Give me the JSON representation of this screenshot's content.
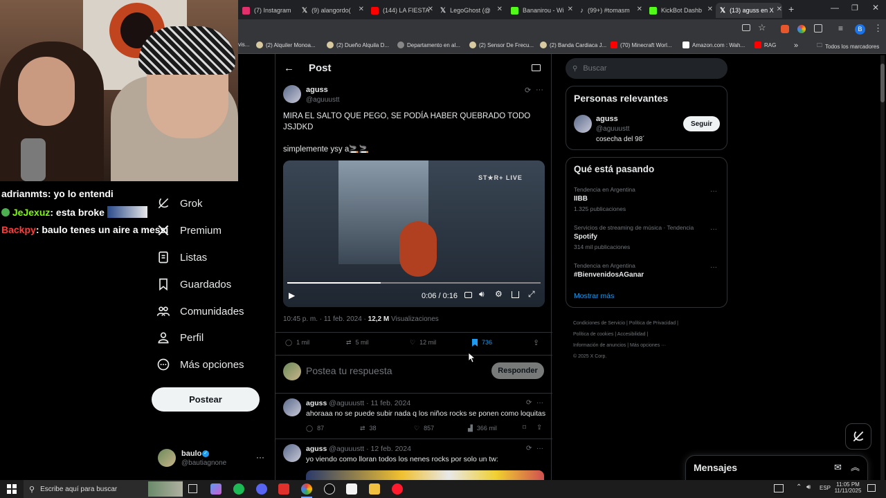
{
  "browser": {
    "tabs": [
      {
        "label": "(7) Instagram",
        "color": "#e1306c"
      },
      {
        "label": "(9) alangordo(",
        "color": "#ffffff"
      },
      {
        "label": "(144) LA FIESTA",
        "color": "#ff0000"
      },
      {
        "label": "LegoGhost (@",
        "color": "#ffffff"
      },
      {
        "label": "Bananirou - Wi",
        "color": "#53fc18"
      },
      {
        "label": "(99+) #tomasm",
        "color": "#ffffff"
      },
      {
        "label": "KickBot Dashb",
        "color": "#53fc18"
      },
      {
        "label": "(13) aguss en X",
        "color": "#ffffff"
      }
    ],
    "new_tab": "+",
    "bookmarks": [
      "vis...",
      "(2) Alquiler Monoa...",
      "(2) Dueño Alquila D...",
      "Departamento en al...",
      "(2) Sensor De Frecu...",
      "(2) Banda Cardiaca J...",
      "(70) Minecraft Worl...",
      "Amazon.com : Wah...",
      "RAG"
    ],
    "all_bookmarks": "Todos los marcadores",
    "profile_initial": "B"
  },
  "stream": {
    "chat": [
      {
        "user": "adrianmts",
        "user_color": "#ffffff",
        "message": ": yo lo entendi"
      },
      {
        "user": "JeJexuz",
        "user_color": "#7cfc00",
        "message": ": esta broke"
      },
      {
        "user": "Backpy",
        "user_color": "#ff3b3b",
        "message": ": baulo tenes un aire a messi"
      }
    ]
  },
  "left_nav": {
    "items": [
      {
        "label": "Grok",
        "icon": "grok-icon"
      },
      {
        "label": "Premium",
        "icon": "x-premium-icon"
      },
      {
        "label": "Listas",
        "icon": "list-icon"
      },
      {
        "label": "Guardados",
        "icon": "bookmark-icon"
      },
      {
        "label": "Comunidades",
        "icon": "communities-icon"
      },
      {
        "label": "Perfil",
        "icon": "profile-icon"
      },
      {
        "label": "Más opciones",
        "icon": "more-icon"
      }
    ],
    "post_button": "Postear",
    "account": {
      "name": "baulo",
      "handle": "@bautiagnone"
    }
  },
  "post": {
    "header_title": "Post",
    "author_name": "aguss",
    "author_handle": "@aguuustt",
    "text_line1": "MIRA EL SALTO QUE PEGO, SE PODÍA HABER QUEBRADO TODO JSJDKD",
    "text_line2": "simplemente ysy a🚬🚬",
    "video": {
      "watermark": "ST★R+ LIVE",
      "time": "0:06 / 0:16",
      "progress": 0.37
    },
    "timestamp": "10:45 p. m. · 11 feb. 2024 ·",
    "views_count": "12,2 M",
    "views_label": "Visualizaciones",
    "stats": {
      "replies": "1 mil",
      "reposts": "5 mil",
      "likes": "12 mil",
      "bookmarks": "736"
    },
    "reply_placeholder": "Postea tu respuesta",
    "reply_button": "Responder"
  },
  "replies": [
    {
      "name": "aguss",
      "handle": "@aguuustt · 11 feb. 2024",
      "text": "ahoraaa no se puede subir nada q los niños rocks se ponen como loquitas",
      "replies": "87",
      "reposts": "38",
      "likes": "857",
      "views": "366 mil"
    },
    {
      "name": "aguss",
      "handle": "@aguuustt · 12 feb. 2024",
      "text": "yo viendo como lloran todos los nenes rocks por solo un tw:"
    }
  ],
  "sidebar": {
    "search_placeholder": "Buscar",
    "relevant": {
      "title": "Personas relevantes",
      "name": "aguss",
      "handle": "@aguuustt",
      "bio": "cosecha del 98´",
      "follow": "Seguir"
    },
    "trending": {
      "title": "Qué está pasando",
      "items": [
        {
          "context": "Tendencia en Argentina",
          "topic": "IIBB",
          "count": "1.325 publicaciones"
        },
        {
          "context": "Servicios de streaming de música · Tendencia",
          "topic": "Spotify",
          "count": "314 mil publicaciones"
        },
        {
          "context": "Tendencia en Argentina",
          "topic": "#BienvenidosAGanar",
          "count": ""
        }
      ],
      "show_more": "Mostrar más"
    },
    "footer": {
      "row1": [
        "Condiciones de Servicio",
        "Política de Privacidad"
      ],
      "row2": [
        "Política de cookies",
        "Accesibilidad"
      ],
      "row3": [
        "Información de anuncios",
        "Más opciones ···"
      ],
      "copyright": "© 2025 X Corp."
    },
    "messages": "Mensajes"
  },
  "taskbar": {
    "search_placeholder": "Escribe aquí para buscar",
    "lang": "ESP",
    "time": "11:05 PM",
    "date": "11/11/2025"
  }
}
